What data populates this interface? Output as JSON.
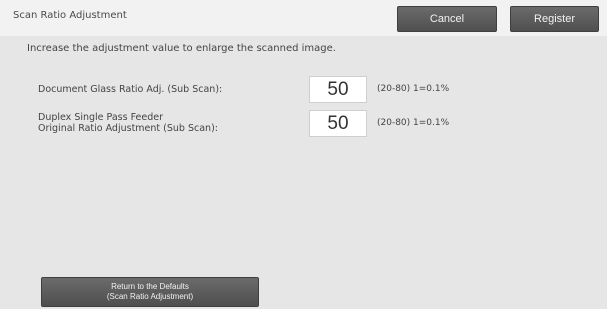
{
  "header": {
    "title": "Scan Ratio Adjustment",
    "cancel_label": "Cancel",
    "register_label": "Register"
  },
  "instruction": "Increase the adjustment value to enlarge the scanned image.",
  "settings": [
    {
      "label_line1": "Document Glass Ratio Adj. (Sub Scan):",
      "label_line2": "",
      "value": "50",
      "range": "(20-80) 1=0.1%"
    },
    {
      "label_line1": "Duplex Single Pass Feeder",
      "label_line2": "Original Ratio Adjustment (Sub Scan):",
      "value": "50",
      "range": "(20-80) 1=0.1%"
    }
  ],
  "footer": {
    "defaults_line1": "Return to the Defaults",
    "defaults_line2": "(Scan Ratio Adjustment)"
  }
}
